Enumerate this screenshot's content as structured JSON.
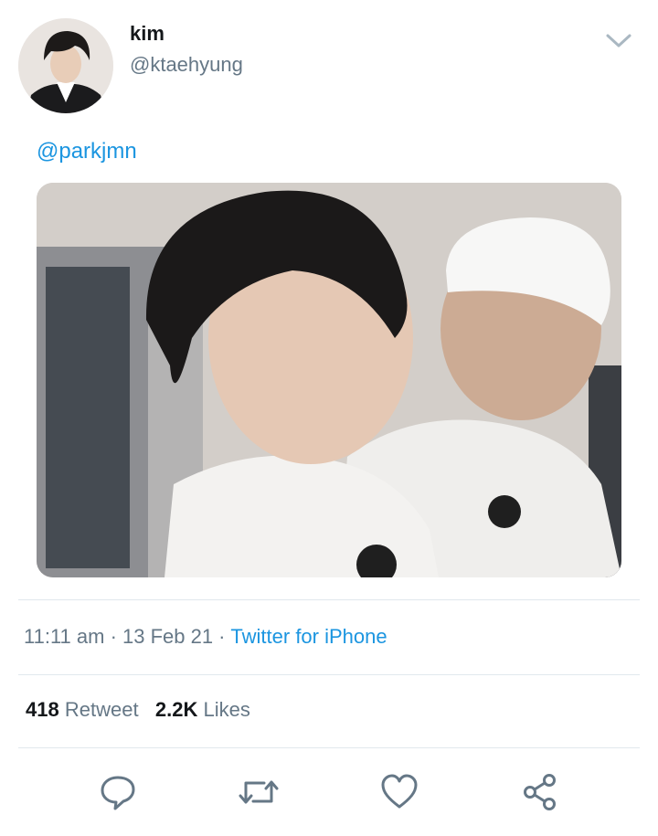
{
  "tweet": {
    "author": {
      "display_name": "kim",
      "handle": "@ktaehyung"
    },
    "text_mention": "@parkjmn",
    "timestamp": "11:11 am · 13 Feb 21",
    "source": "Twitter for iPhone",
    "stats": {
      "retweets": "418",
      "retweets_label": "Retweet",
      "likes": "2.2K",
      "likes_label": "Likes"
    }
  },
  "icons": {
    "menu": "chevron-down-icon",
    "reply": "reply-icon",
    "retweet": "retweet-icon",
    "like": "heart-icon",
    "share": "share-icon"
  },
  "colors": {
    "link": "#1b95e0",
    "secondary_text": "#657786",
    "primary_text": "#14171a",
    "divider": "#e1e8ed"
  }
}
